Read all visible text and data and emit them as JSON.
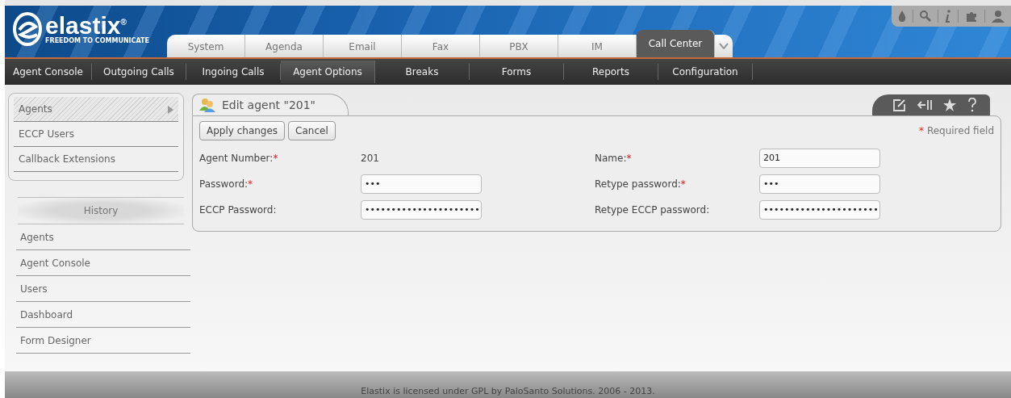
{
  "brand": {
    "name": "elastix",
    "registered": "®",
    "tagline": "FREEDOM TO COMMUNICATE"
  },
  "tabs": [
    {
      "label": "System",
      "selected": false
    },
    {
      "label": "Agenda",
      "selected": false
    },
    {
      "label": "Email",
      "selected": false
    },
    {
      "label": "Fax",
      "selected": false
    },
    {
      "label": "PBX",
      "selected": false
    },
    {
      "label": "IM",
      "selected": false
    },
    {
      "label": "Call Center",
      "selected": true
    }
  ],
  "subnav": [
    {
      "label": "Agent Console",
      "selected": false
    },
    {
      "label": "Outgoing Calls",
      "selected": false
    },
    {
      "label": "Ingoing Calls",
      "selected": false
    },
    {
      "label": "Agent Options",
      "selected": true
    },
    {
      "label": "Breaks",
      "selected": false
    },
    {
      "label": "Forms",
      "selected": false
    },
    {
      "label": "Reports",
      "selected": false
    },
    {
      "label": "Configuration",
      "selected": false
    }
  ],
  "sidebar": {
    "items": [
      {
        "label": "Agents",
        "selected": true
      },
      {
        "label": "ECCP Users",
        "selected": false
      },
      {
        "label": "Callback Extensions",
        "selected": false
      }
    ],
    "history_title": "History",
    "history": [
      "Agents",
      "Agent Console",
      "Users",
      "Dashboard",
      "Form Designer"
    ]
  },
  "panel": {
    "title": "Edit agent \"201\"",
    "buttons": [
      "Apply changes",
      "Cancel"
    ],
    "required_note": "Required field",
    "required_mark": "*",
    "fields": [
      {
        "label": "Agent Number:",
        "required": true,
        "kind": "text",
        "value": "201"
      },
      {
        "label": "Name:",
        "required": true,
        "kind": "input",
        "value": "201"
      },
      {
        "label": "Password:",
        "required": true,
        "kind": "input",
        "value": "•••"
      },
      {
        "label": "Retype password:",
        "required": true,
        "kind": "input",
        "value": "•••"
      },
      {
        "label": "ECCP Password:",
        "required": false,
        "kind": "input",
        "value": "••••••••••••••••••••••"
      },
      {
        "label": "Retype ECCP password:",
        "required": false,
        "kind": "input",
        "value": "••••••••••••••••••••••"
      }
    ]
  },
  "footer": "Elastix is licensed under GPL by PaloSanto Solutions. 2006 - 2013."
}
